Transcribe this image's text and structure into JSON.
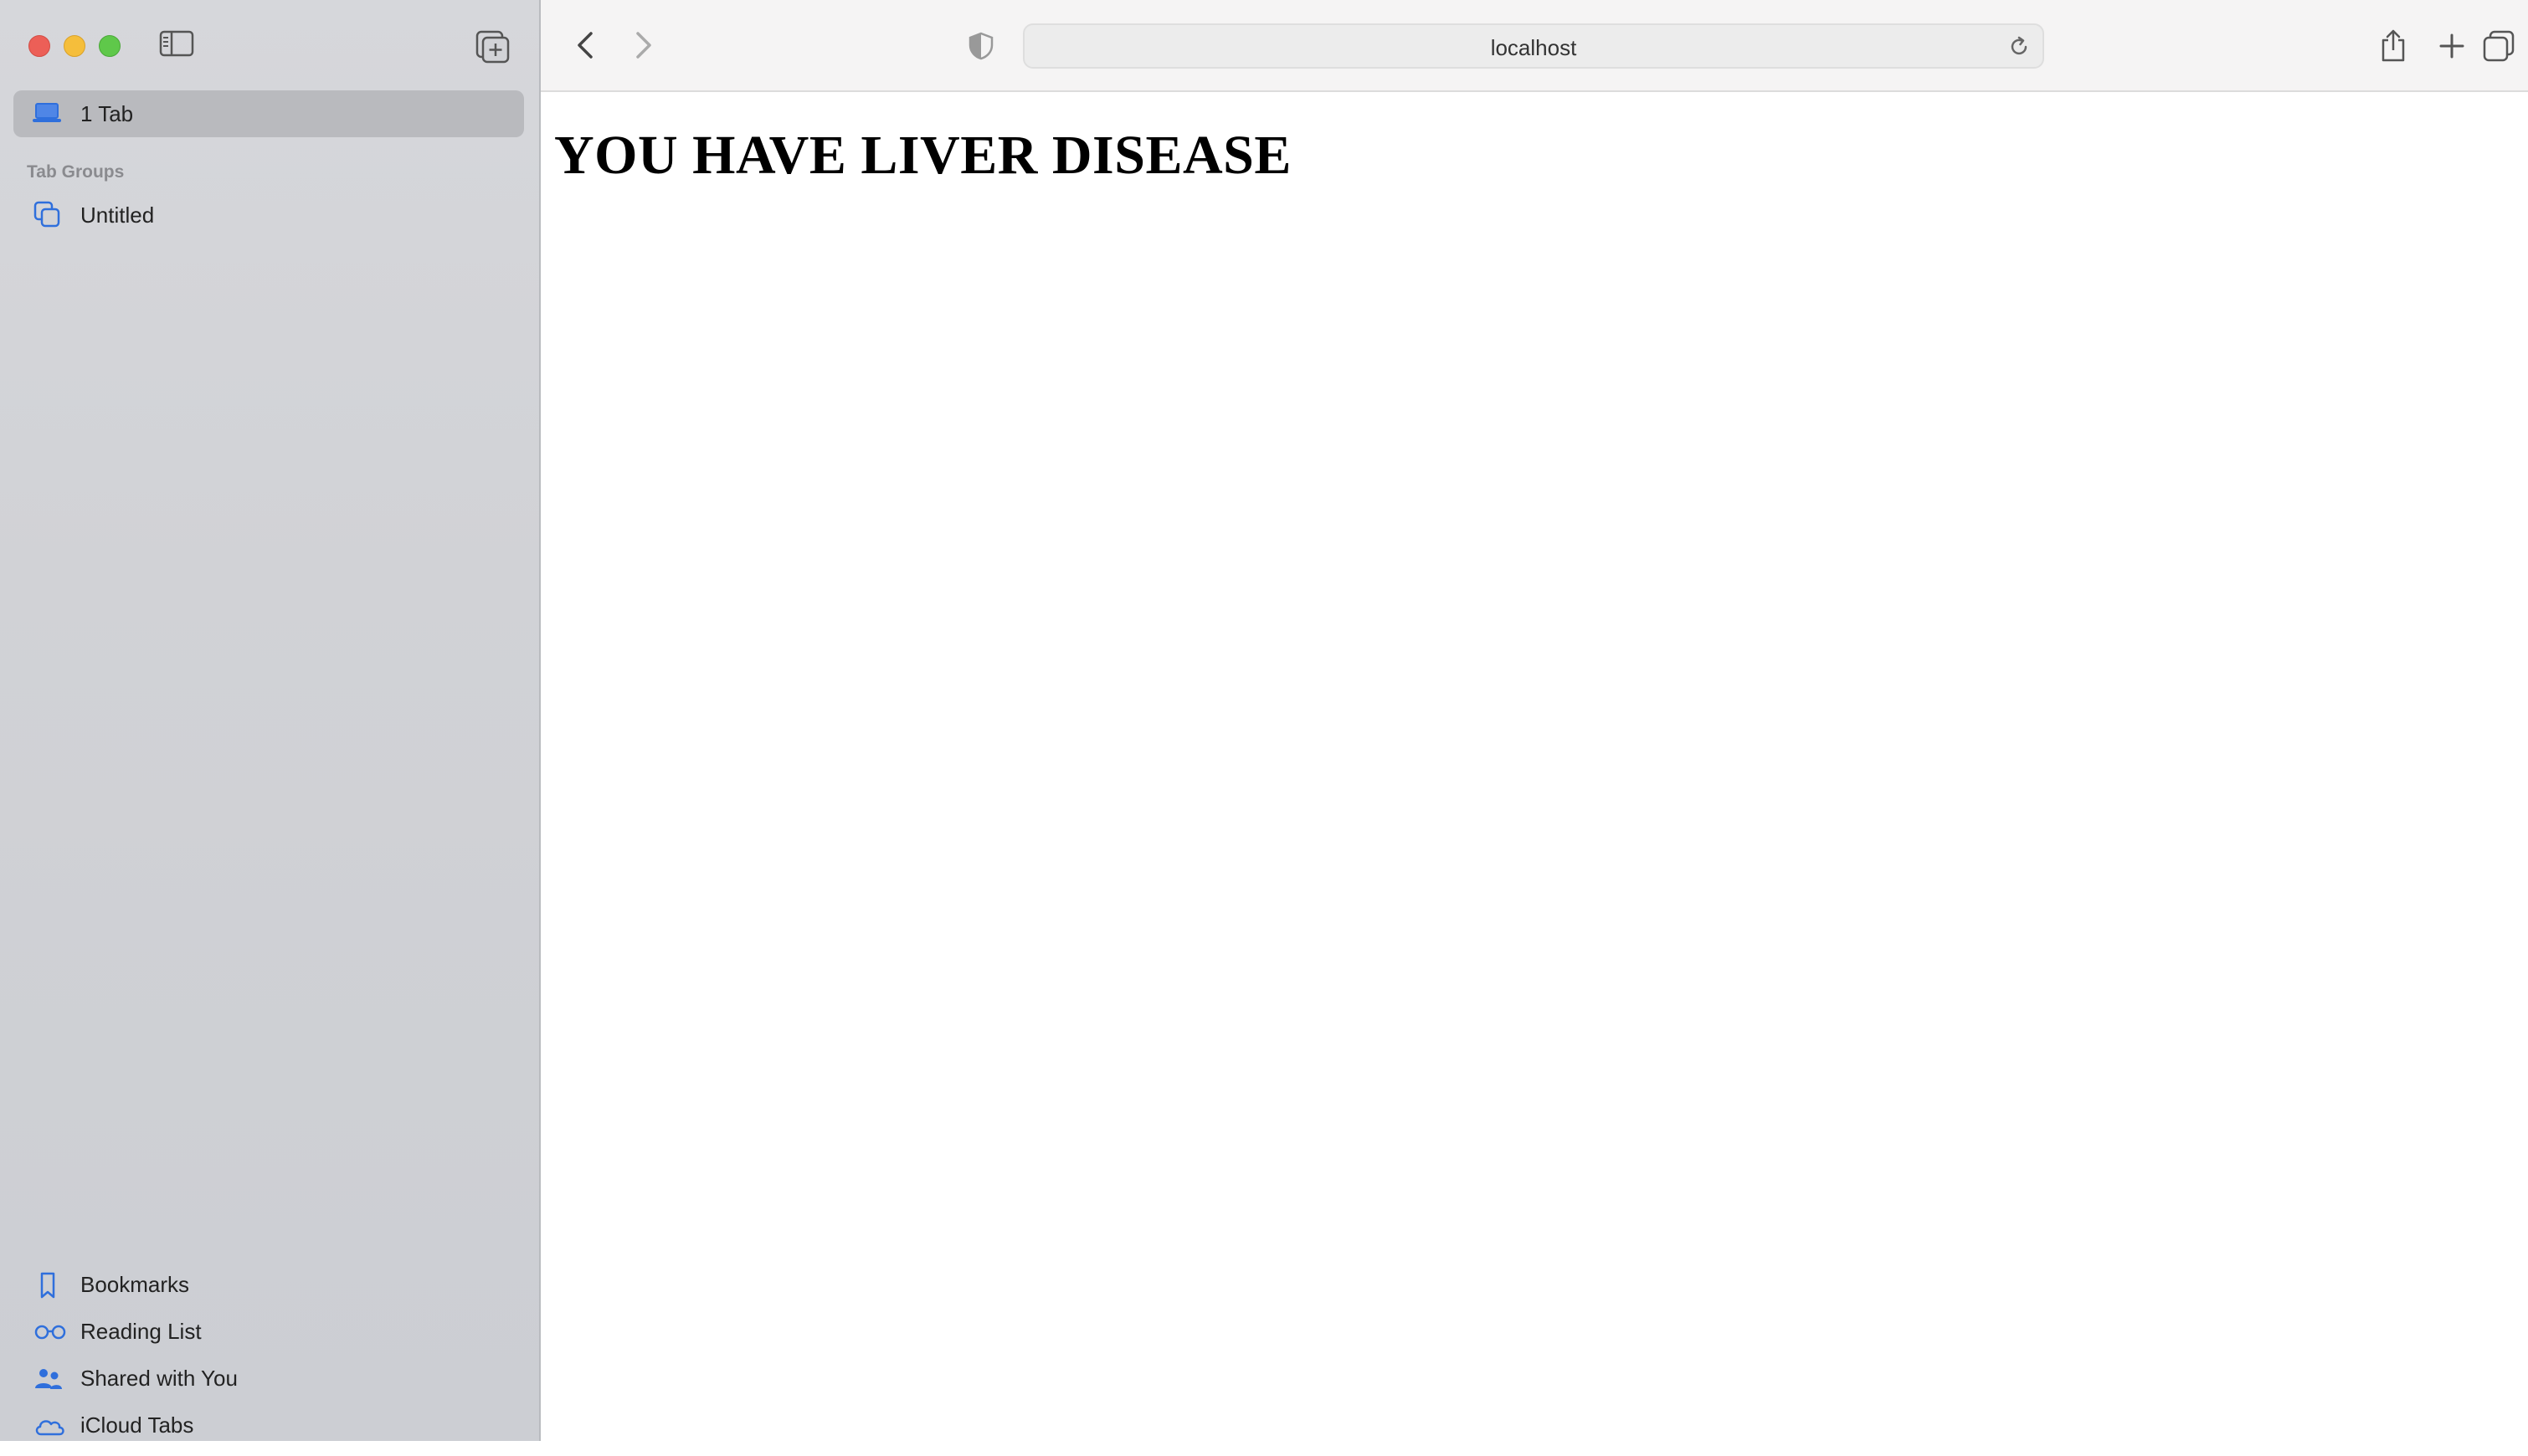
{
  "sidebar": {
    "current_tabs_label": "1 Tab",
    "section_label": "Tab Groups",
    "group_items": [
      {
        "label": "Untitled"
      }
    ],
    "bottom_items": [
      {
        "label": "Bookmarks",
        "icon": "bookmark-icon"
      },
      {
        "label": "Reading List",
        "icon": "reading-list-icon"
      },
      {
        "label": "Shared with You",
        "icon": "shared-with-you-icon"
      },
      {
        "label": "iCloud Tabs",
        "icon": "icloud-icon"
      }
    ]
  },
  "toolbar": {
    "address": "localhost"
  },
  "page": {
    "heading": "YOU HAVE LIVER DISEASE"
  },
  "colors": {
    "accent": "#2f6fdc",
    "sidebar_bg": "#d2d3d7",
    "selected_row": "#b9babe"
  }
}
